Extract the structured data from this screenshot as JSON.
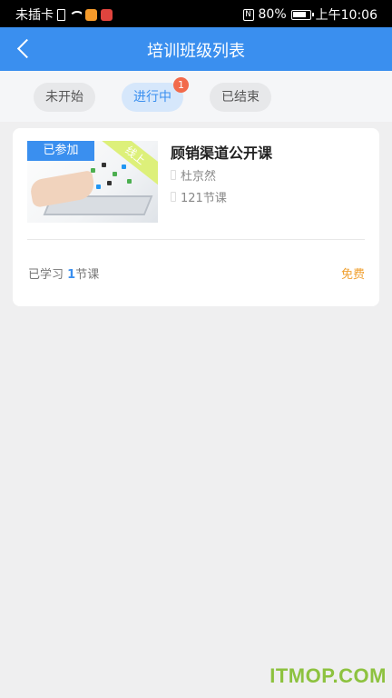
{
  "status_bar": {
    "carrier": "未插卡",
    "battery": "80%",
    "time": "上午10:06",
    "nfc": "N"
  },
  "header": {
    "title": "培训班级列表"
  },
  "tabs": [
    {
      "label": "未开始",
      "active": false
    },
    {
      "label": "进行中",
      "active": true,
      "badge": "1"
    },
    {
      "label": "已结束",
      "active": false
    }
  ],
  "course": {
    "joined_badge": "已参加",
    "ribbon": "线上",
    "title": "顾销渠道公开课",
    "teacher": "杜京然",
    "lessons": "121节课",
    "progress_prefix": "已学习",
    "progress_count": "1",
    "progress_suffix": "节课",
    "price": "免费"
  },
  "watermark": "ITMOP.COM",
  "colors": {
    "primary": "#3a8fef",
    "badge": "#f26a4b",
    "price": "#f0a030"
  }
}
